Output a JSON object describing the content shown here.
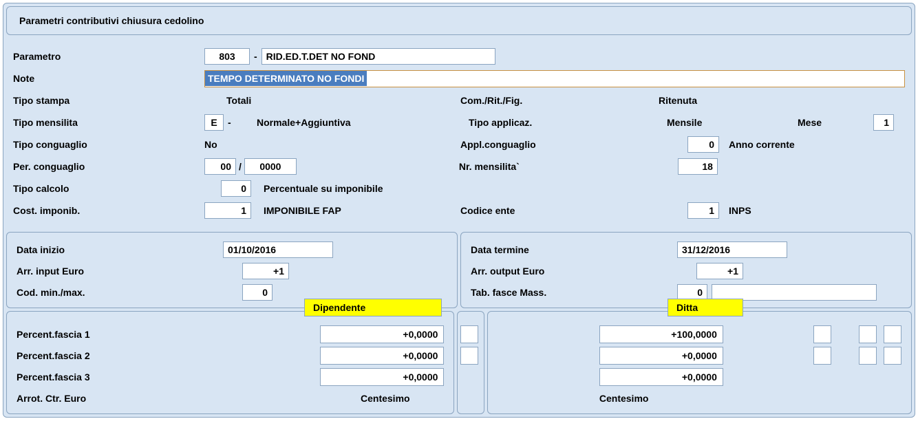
{
  "title": "Parametri contributivi chiusura cedolino",
  "rows": {
    "parametro": {
      "label": "Parametro",
      "code": "803",
      "desc": "RID.ED.T.DET NO FOND"
    },
    "note": {
      "label": "Note",
      "value": "TEMPO DETERMINATO NO FONDI"
    },
    "tipoStampa": {
      "label": "Tipo stampa",
      "value": "Totali",
      "midLabel": "Com./Rit./Fig.",
      "midValue": "Ritenuta"
    },
    "tipoMensilita": {
      "label": "Tipo mensilita",
      "code": "E",
      "desc": "Normale+Aggiuntiva",
      "midLabel": "Tipo applicaz.",
      "midVal": "Mensile",
      "meseLabel": "Mese",
      "meseVal": "1"
    },
    "tipoConguaglio": {
      "label": "Tipo conguaglio",
      "value": "No",
      "midLabel": "Appl.conguaglio",
      "midCode": "0",
      "midDesc": "Anno corrente"
    },
    "perConguaglio": {
      "label": "Per. conguaglio",
      "mm": "00",
      "yyyy": "0000",
      "midLabel": "Nr. mensilita`",
      "midVal": "18"
    },
    "tipoCalcolo": {
      "label": "Tipo calcolo",
      "code": "0",
      "desc": "Percentuale su imponibile"
    },
    "costImponib": {
      "label": "Cost. imponib.",
      "code": "1",
      "desc": "IMPONIBILE FAP",
      "midLabel": "Codice ente",
      "midCode": "1",
      "midDesc": "INPS"
    }
  },
  "subLeft": {
    "dataInizio": {
      "label": "Data inizio",
      "value": "01/10/2016"
    },
    "arrInput": {
      "label": "Arr. input Euro",
      "value": "+1"
    },
    "codMinMax": {
      "label": "Cod. min./max.",
      "value": "0"
    },
    "tag": "Dipendente"
  },
  "subRight": {
    "dataTermine": {
      "label": "Data termine",
      "value": "31/12/2016"
    },
    "arrOutput": {
      "label": "Arr. output Euro",
      "value": "+1"
    },
    "tabFasce": {
      "label": "Tab. fasce Mass.",
      "value": "0"
    },
    "tag": "Ditta"
  },
  "fasce": {
    "f1": {
      "label": "Percent.fascia 1",
      "dip": "+0,0000",
      "dit": "+100,0000"
    },
    "f2": {
      "label": "Percent.fascia 2",
      "dip": "+0,0000",
      "dit": "+0,0000"
    },
    "f3": {
      "label": "Percent.fascia 3",
      "dip": "+0,0000",
      "dit": "+0,0000"
    },
    "arrot": {
      "label": "Arrot. Ctr. Euro",
      "dip": "Centesimo",
      "dit": "Centesimo"
    }
  },
  "sep": {
    "dash": "-",
    "slash": "/"
  }
}
